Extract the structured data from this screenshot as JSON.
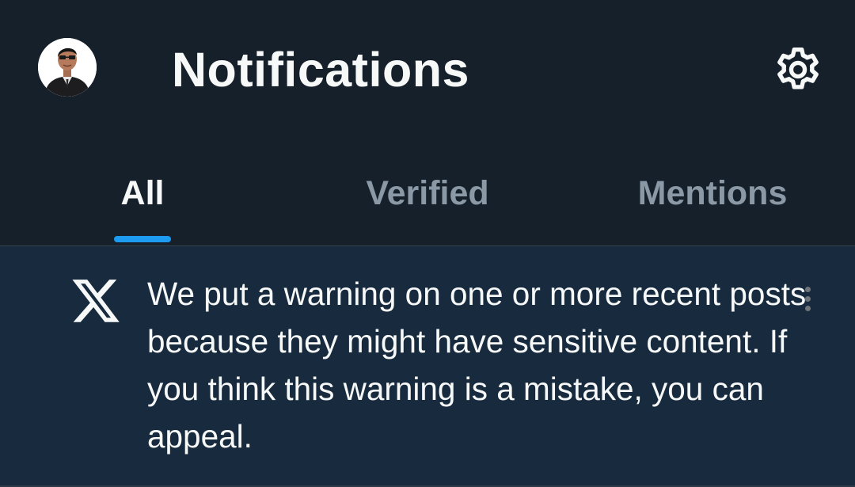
{
  "header": {
    "title": "Notifications",
    "avatar_icon": "profile-photo",
    "settings_icon": "gear-icon"
  },
  "tabs": [
    {
      "label": "All",
      "active": true
    },
    {
      "label": "Verified",
      "active": false
    },
    {
      "label": "Mentions",
      "active": false
    }
  ],
  "notification": {
    "icon": "x-logo-icon",
    "text": "We put a warning on one or more recent posts because they might have sensitive content. If you think this warning is a mistake, you can appeal.",
    "more_icon": "more-vertical-icon"
  },
  "colors": {
    "background": "#15202b",
    "notification_background": "#172a3e",
    "accent": "#1d9bf0",
    "text_primary": "#f7f9f9",
    "text_secondary": "#8b98a5"
  }
}
